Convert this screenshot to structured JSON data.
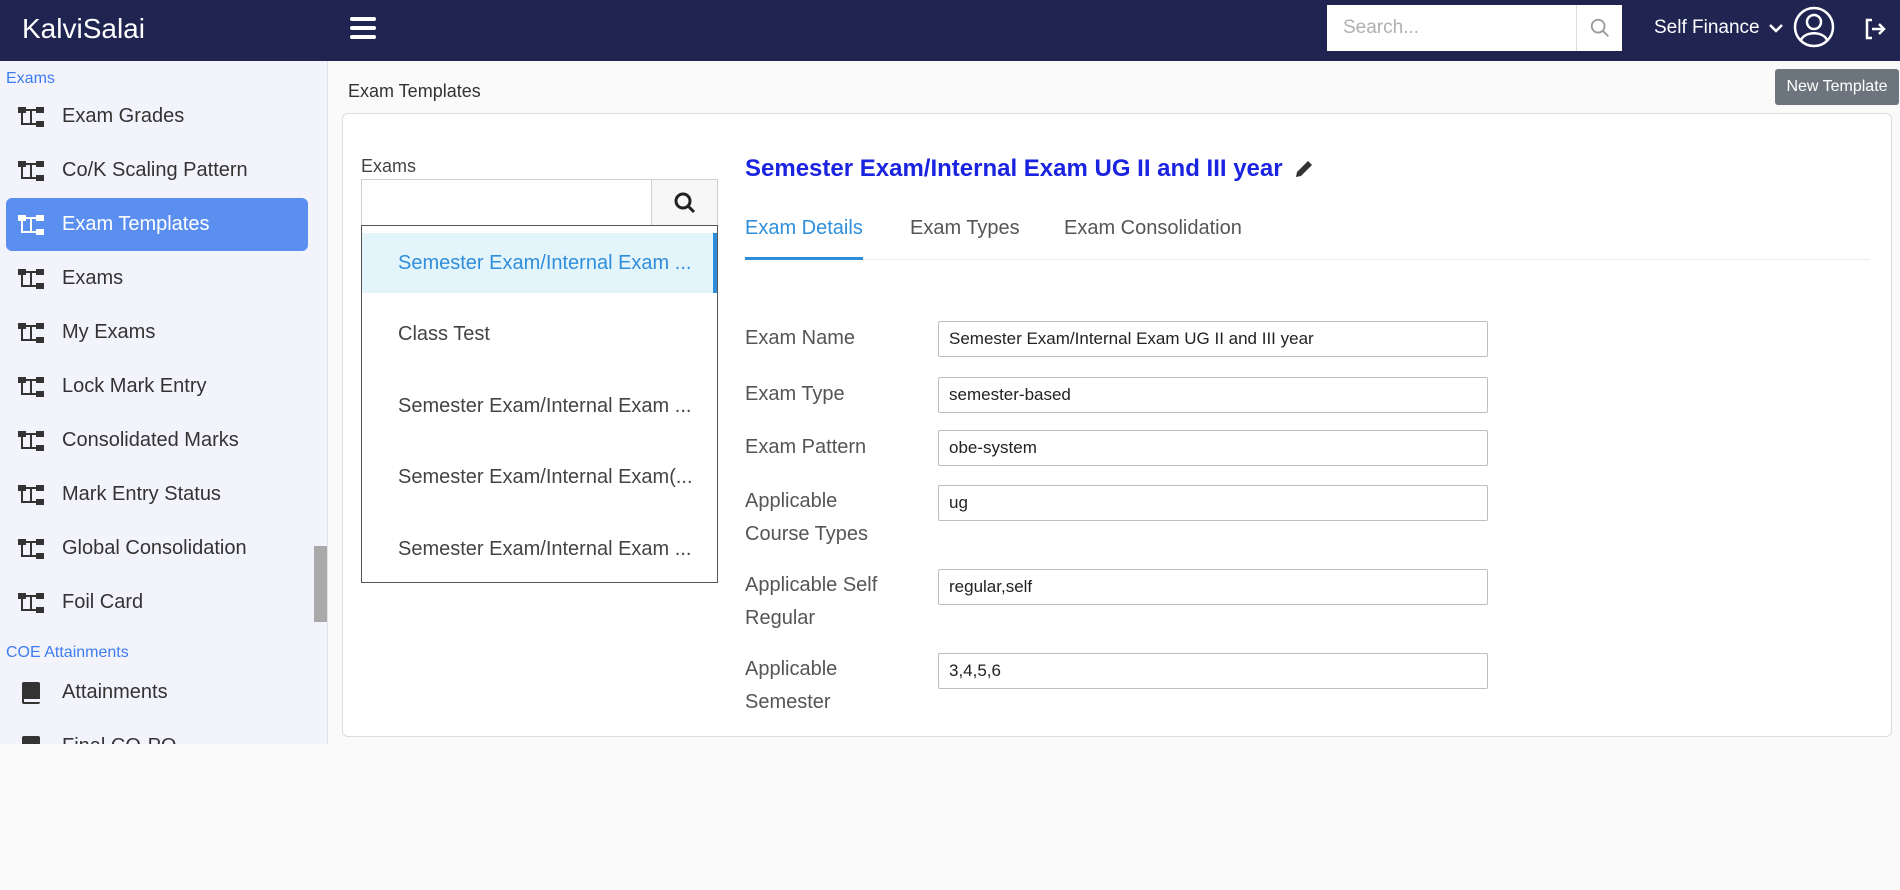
{
  "header": {
    "brand": "KalviSalai",
    "search_placeholder": "Search...",
    "org_selector": "Self Finance"
  },
  "sidebar": {
    "sections": [
      {
        "label": "Exams"
      },
      {
        "label": "COE Attainments"
      }
    ],
    "items": [
      {
        "label": "Exam Grades",
        "icon": "hierarchy-icon"
      },
      {
        "label": "Co/K Scaling Pattern",
        "icon": "hierarchy-icon"
      },
      {
        "label": "Exam Templates",
        "icon": "hierarchy-icon",
        "active": true
      },
      {
        "label": "Exams",
        "icon": "hierarchy-icon"
      },
      {
        "label": "My Exams",
        "icon": "hierarchy-icon"
      },
      {
        "label": "Lock Mark Entry",
        "icon": "hierarchy-icon"
      },
      {
        "label": "Consolidated Marks",
        "icon": "hierarchy-icon"
      },
      {
        "label": "Mark Entry Status",
        "icon": "hierarchy-icon"
      },
      {
        "label": "Global Consolidation",
        "icon": "hierarchy-icon"
      },
      {
        "label": "Foil Card",
        "icon": "hierarchy-icon"
      },
      {
        "label": "Attainments",
        "icon": "book-icon"
      },
      {
        "label": "Final CO-PO",
        "icon": "book-icon"
      }
    ]
  },
  "main": {
    "page_title": "Exam Templates",
    "new_template_label": "New Template",
    "exams_label": "Exams",
    "exam_list": [
      {
        "label": "Semester Exam/Internal Exam ...",
        "selected": true
      },
      {
        "label": "Class Test"
      },
      {
        "label": "Semester Exam/Internal Exam ..."
      },
      {
        "label": "Semester Exam/Internal Exam(..."
      },
      {
        "label": "Semester Exam/Internal Exam ..."
      }
    ],
    "detail_title": "Semester Exam/Internal Exam UG II and III year",
    "tabs": [
      {
        "label": "Exam Details",
        "active": true
      },
      {
        "label": "Exam Types"
      },
      {
        "label": "Exam Consolidation"
      }
    ],
    "fields": [
      {
        "label_lines": [
          "Exam Name"
        ],
        "value": "Semester Exam/Internal Exam UG II and III year"
      },
      {
        "label_lines": [
          "Exam Type"
        ],
        "value": "semester-based"
      },
      {
        "label_lines": [
          "Exam Pattern"
        ],
        "value": "obe-system"
      },
      {
        "label_lines": [
          "Applicable",
          "Course Types"
        ],
        "value": "ug"
      },
      {
        "label_lines": [
          "Applicable Self",
          "Regular"
        ],
        "value": "regular,self"
      },
      {
        "label_lines": [
          "Applicable",
          "Semester"
        ],
        "value": "3,4,5,6"
      }
    ]
  },
  "colors": {
    "header_bg": "#1f2550",
    "accent": "#5a8ff0",
    "link_blue": "#2f8edb",
    "title_blue": "#1a23e0"
  }
}
